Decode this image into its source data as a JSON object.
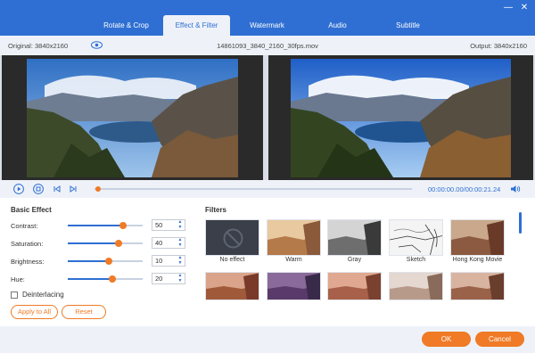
{
  "tabs": [
    {
      "label": "Rotate & Crop"
    },
    {
      "label": "Effect & Filter"
    },
    {
      "label": "Watermark"
    },
    {
      "label": "Audio"
    },
    {
      "label": "Subtitle"
    }
  ],
  "preview": {
    "original_label": "Original: 3840x2160",
    "file_name": "14861093_3840_2160_30fps.mov",
    "output_label": "Output: 3840x2160"
  },
  "player": {
    "time": "00:00:00.00/00:00:21.24",
    "progress": 0.01
  },
  "basic_effect": {
    "title": "Basic Effect",
    "rows": [
      {
        "label": "Contrast:",
        "value": "50",
        "level": 0.74
      },
      {
        "label": "Saturation:",
        "value": "40",
        "level": 0.68
      },
      {
        "label": "Brightness:",
        "value": "10",
        "level": 0.55
      },
      {
        "label": "Hue:",
        "value": "20",
        "level": 0.59
      }
    ],
    "deinterlacing": "Deinterlacing",
    "apply_all": "Apply to All",
    "reset": "Reset"
  },
  "filters": {
    "title": "Filters",
    "row1": [
      {
        "label": "No effect"
      },
      {
        "label": "Warm"
      },
      {
        "label": "Gray"
      },
      {
        "label": "Sketch"
      },
      {
        "label": "Hong Kong Movie"
      }
    ]
  },
  "footer": {
    "ok": "OK",
    "cancel": "Cancel"
  },
  "colors": {
    "accent": "#2f6fd3",
    "orange": "#f07a25"
  }
}
